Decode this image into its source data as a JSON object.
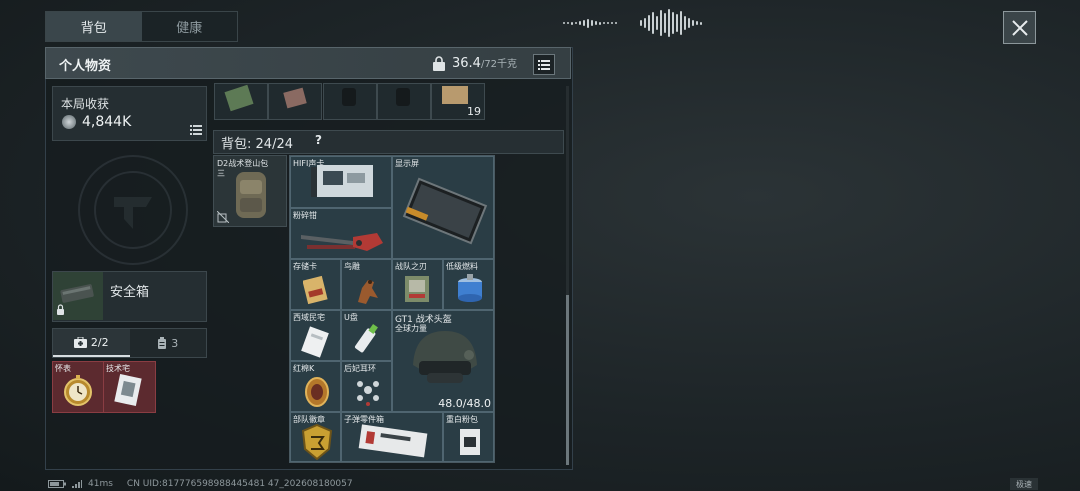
{
  "tabs": [
    {
      "label": "背包",
      "active": true
    },
    {
      "label": "健康",
      "active": false
    }
  ],
  "panel": {
    "title": "个人物资",
    "weight_current": "36.4",
    "weight_max": "/72千克"
  },
  "harvest": {
    "label": "本局收获",
    "value": "4,844K"
  },
  "safebox": {
    "label": "安全箱"
  },
  "subtabs": [
    {
      "label": "2/2",
      "icon": "medkit-icon"
    },
    {
      "label": "3",
      "icon": "canister-icon"
    }
  ],
  "safe_slots": [
    {
      "label": "怀表"
    },
    {
      "label": "技术宅"
    }
  ],
  "gear_row": {
    "last_count": "19"
  },
  "bag": {
    "label": "背包:",
    "count": "24/24",
    "help": "?"
  },
  "backpack": {
    "label": "D2战术登山包",
    "sub": "三"
  },
  "items": {
    "hifi": "HIFI声卡",
    "display": "显示屏",
    "crusher": "粉碎钳",
    "sdcard": "存储卡",
    "bird": "鸟雕",
    "squad_blade": "战队之刃",
    "fuel": "低级燃料",
    "western": "西域民宅",
    "usb": "U盘",
    "helmet_name": "GT1 战术头盔",
    "helmet_sub": "全球力量",
    "helmet_durability": "48.0/48.0",
    "redmedal": "红棉K",
    "earring": "后妃耳环",
    "badge": "部队徽章",
    "bullet_parts": "子弹零件箱",
    "sugar": "重白粉包"
  },
  "status": {
    "ping": "41ms",
    "uid": "CN UID:817776598988445481 47_202608180057"
  },
  "speed_label": "极速"
}
